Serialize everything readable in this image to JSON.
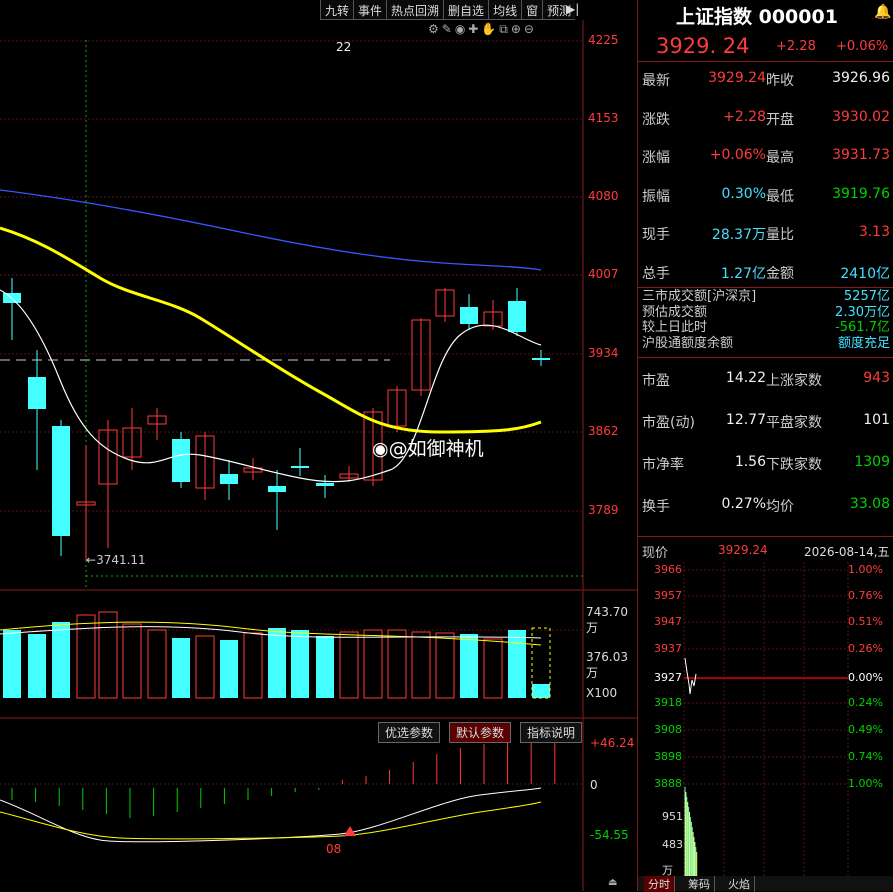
{
  "toolbar": [
    "九转",
    "事件",
    "热点回溯",
    "删自选",
    "均线",
    "窗",
    "预测"
  ],
  "main": {
    "top_number": "22",
    "price_ticks": [
      "4225",
      "4153",
      "4080",
      "4007",
      "3934",
      "3862",
      "3789"
    ],
    "low_marker": "3741.11",
    "volume_ticks": [
      "743.70万",
      "376.03万",
      "X100"
    ],
    "indicator_ticks": [
      "+46.24",
      "0",
      "-54.55"
    ],
    "date_marker": "08",
    "indicator_tabs": [
      "优选参数",
      "默认参数",
      "指标说明"
    ],
    "watermark": "@如御神机"
  },
  "header": {
    "title": "上证指数 000001",
    "price": "3929. 24",
    "change": "+2.28",
    "pct": "+0.06%"
  },
  "quote": [
    {
      "l1": "最新",
      "v1": "3929.24",
      "c1": "red",
      "l2": "昨收",
      "v2": "3926.96",
      "c2": "white"
    },
    {
      "l1": "涨跌",
      "v1": "+2.28",
      "c1": "red",
      "l2": "开盘",
      "v2": "3930.02",
      "c2": "red"
    },
    {
      "l1": "涨幅",
      "v1": "+0.06%",
      "c1": "red",
      "l2": "最高",
      "v2": "3931.73",
      "c2": "red"
    },
    {
      "l1": "振幅",
      "v1": "0.30%",
      "c1": "cyan",
      "l2": "最低",
      "v2": "3919.76",
      "c2": "green"
    },
    {
      "l1": "现手",
      "v1": "28.37万",
      "c1": "cyan",
      "l2": "量比",
      "v2": "3.13",
      "c2": "red"
    },
    {
      "l1": "总手",
      "v1": "1.27亿",
      "c1": "cyan",
      "l2": "金额",
      "v2": "2410亿",
      "c2": "cyan"
    }
  ],
  "market": [
    {
      "l": "三市成交额[沪深京]",
      "v": "5257亿",
      "c": "cyan"
    },
    {
      "l": "预估成交额",
      "v": "2.30万亿",
      "c": "cyan"
    },
    {
      "l": "较上日此时",
      "v": "-561.7亿",
      "c": "green"
    },
    {
      "l": "沪股通额度余额",
      "v": "额度充足",
      "c": "cyan"
    }
  ],
  "stats": [
    {
      "l1": "市盈",
      "v1": "14.22",
      "l2": "上涨家数",
      "v2": "943",
      "c2": "red"
    },
    {
      "l1": "市盈(动)",
      "v1": "12.77",
      "l2": "平盘家数",
      "v2": "101",
      "c2": "white"
    },
    {
      "l1": "市净率",
      "v1": "1.56",
      "l2": "下跌家数",
      "v2": "1309",
      "c2": "green"
    },
    {
      "l1": "换手",
      "v1": "0.27%",
      "l2": "均价",
      "v2": "33.08",
      "c2": "green"
    }
  ],
  "mini": {
    "label": "现价",
    "price": "3929.24",
    "date": "2026-08-14,五",
    "left_ticks": [
      "3966",
      "3957",
      "3947",
      "3937",
      "3927",
      "3918",
      "3908",
      "3898",
      "3888"
    ],
    "right_ticks": [
      "1.00%",
      "0.76%",
      "0.51%",
      "0.26%",
      "0.00%",
      "0.24%",
      "0.49%",
      "0.74%",
      "1.00%"
    ],
    "vol_ticks": [
      "951",
      "483",
      "万"
    ]
  },
  "bottom_tabs": [
    "分时",
    "筹码",
    "火焰"
  ],
  "colors": {
    "up": "#ff3b3b",
    "down": "#44ffff",
    "ma1": "#ffffff",
    "ma2": "#ffff00",
    "ma3": "#3b55ff"
  }
}
